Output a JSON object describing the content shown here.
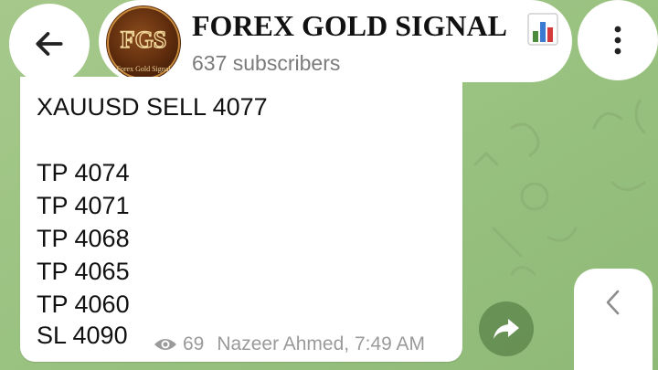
{
  "header": {
    "title": "FOREX GOLD SIGNAL",
    "subscribers": "637 subscribers",
    "avatar_monogram": "FGS",
    "avatar_caption": "Forex Gold Signal",
    "title_icon": "bar-chart-icon"
  },
  "message": {
    "lines": [
      "XAUUSD SELL 4077",
      "TP 4074",
      "TP 4071",
      "TP 4068",
      "TP 4065",
      "TP 4060",
      "SL 4090"
    ],
    "views": "69",
    "author_time": "Nazeer Ahmed, 7:49 AM"
  },
  "icons": {
    "back": "arrow-left-icon",
    "menu": "more-vertical-icon",
    "views": "eye-icon",
    "share": "share-arrow-icon",
    "side": "chevron-left-icon"
  },
  "colors": {
    "wallpaper": "#9cc383",
    "bubble": "#ffffff",
    "meta_text": "#9a9a9a",
    "avatar_brown": "#5b2a0c",
    "gold": "#e8c77a"
  }
}
